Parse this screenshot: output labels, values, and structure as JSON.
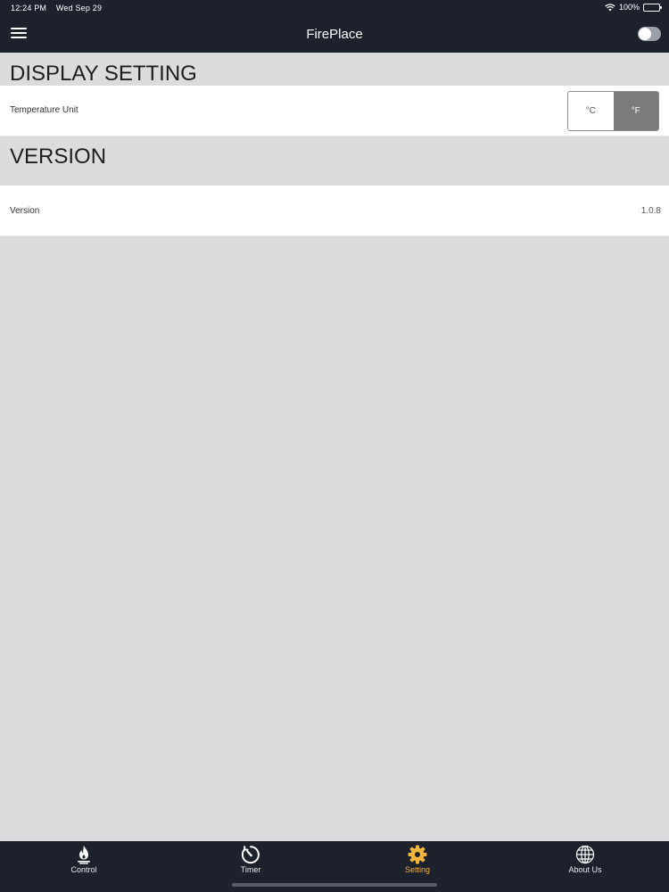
{
  "status_bar": {
    "time": "12:24 PM",
    "date": "Wed Sep 29",
    "battery": "100%"
  },
  "nav": {
    "title": "FirePlace",
    "menu_icon": "hamburger-menu-icon",
    "toggle_state": "off"
  },
  "display_setting": {
    "header": "DISPLAY SETTING",
    "temperature_unit_label": "Temperature Unit",
    "options": [
      "°C",
      "°F"
    ],
    "selected": "°F"
  },
  "version_section": {
    "header": "VERSION",
    "label": "Version",
    "value": "1.0.8"
  },
  "tabs": [
    {
      "label": "Control",
      "icon": "flame-icon"
    },
    {
      "label": "Timer",
      "icon": "timer-icon"
    },
    {
      "label": "Setting",
      "icon": "gear-icon",
      "active": true
    },
    {
      "label": "About Us",
      "icon": "globe-icon"
    }
  ],
  "colors": {
    "bar_background": "#1d212c",
    "active_tab": "#f2b43a",
    "selected_segment": "#7b7b7b",
    "page_background": "#dcdbdd"
  }
}
